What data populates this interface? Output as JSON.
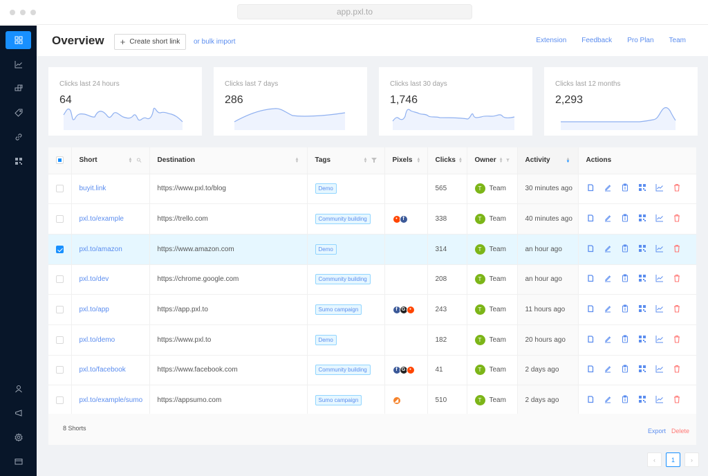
{
  "browser": {
    "url": "app.pxl.to"
  },
  "sidebar": {
    "items": [
      {
        "icon": "dashboard-icon",
        "active": true
      },
      {
        "icon": "analytics-icon",
        "active": false
      },
      {
        "icon": "blocks-icon",
        "active": false
      },
      {
        "icon": "tag-icon",
        "active": false
      },
      {
        "icon": "link-icon",
        "active": false
      },
      {
        "icon": "qr-code-icon",
        "active": false
      }
    ],
    "bottom_items": [
      {
        "icon": "user-icon"
      },
      {
        "icon": "megaphone-icon"
      },
      {
        "icon": "gear-icon"
      },
      {
        "icon": "billing-card-icon"
      }
    ]
  },
  "header": {
    "title": "Overview",
    "create_button": "Create short link",
    "bulk_import": "or bulk import",
    "nav": [
      "Extension",
      "Feedback",
      "Pro Plan",
      "Team"
    ]
  },
  "stats": [
    {
      "label": "Clicks last 24 hours",
      "value": "64"
    },
    {
      "label": "Clicks last 7 days",
      "value": "286"
    },
    {
      "label": "Clicks last 30 days",
      "value": "1,746"
    },
    {
      "label": "Clicks last 12 months",
      "value": "2,293"
    }
  ],
  "table": {
    "columns": [
      "Short",
      "Destination",
      "Tags",
      "Pixels",
      "Clicks",
      "Owner",
      "Activity",
      "Actions"
    ],
    "rows": [
      {
        "short": "buyit.link",
        "destination": "https://www.pxl.to/blog",
        "tag": "Demo",
        "pixels": [],
        "clicks": "565",
        "owner": "Team",
        "owner_initial": "T",
        "activity": "30 minutes ago",
        "selected": false
      },
      {
        "short": "pxl.to/example",
        "destination": "https://trello.com",
        "tag": "Community building",
        "pixels": [
          "reddit",
          "facebook"
        ],
        "clicks": "338",
        "owner": "Team",
        "owner_initial": "T",
        "activity": "40 minutes ago",
        "selected": false
      },
      {
        "short": "pxl.to/amazon",
        "destination": "https://www.amazon.com",
        "tag": "Demo",
        "pixels": [],
        "clicks": "314",
        "owner": "Team",
        "owner_initial": "T",
        "activity": "an hour ago",
        "selected": true
      },
      {
        "short": "pxl.to/dev",
        "destination": "https://chrome.google.com",
        "tag": "Community building",
        "pixels": [],
        "clicks": "208",
        "owner": "Team",
        "owner_initial": "T",
        "activity": "an hour ago",
        "selected": false
      },
      {
        "short": "pxl.to/app",
        "destination": "https://app.pxl.to",
        "tag": "Sumo campaign",
        "pixels": [
          "facebook",
          "google",
          "reddit"
        ],
        "clicks": "243",
        "owner": "Team",
        "owner_initial": "T",
        "activity": "11 hours ago",
        "selected": false
      },
      {
        "short": "pxl.to/demo",
        "destination": "https://www.pxl.to",
        "tag": "Demo",
        "pixels": [],
        "clicks": "182",
        "owner": "Team",
        "owner_initial": "T",
        "activity": "20 hours ago",
        "selected": false
      },
      {
        "short": "pxl.to/facebook",
        "destination": "https://www.facebook.com",
        "tag": "Community building",
        "pixels": [
          "facebook",
          "google",
          "reddit"
        ],
        "clicks": "41",
        "owner": "Team",
        "owner_initial": "T",
        "activity": "2 days ago",
        "selected": false
      },
      {
        "short": "pxl.to/example/sumo",
        "destination": "https://appsumo.com",
        "tag": "Sumo campaign",
        "pixels": [
          "other"
        ],
        "clicks": "510",
        "owner": "Team",
        "owner_initial": "T",
        "activity": "2 days ago",
        "selected": false
      }
    ],
    "actions": [
      "copy-icon",
      "edit-icon",
      "clipboard-icon",
      "qr-code-icon",
      "analytics-icon",
      "delete-icon"
    ]
  },
  "footer": {
    "total": "8 Shorts",
    "export": "Export",
    "delete": "Delete"
  },
  "pagination": {
    "current": "1",
    "prev": "‹",
    "next": "›"
  },
  "colors": {
    "accent": "#1890ff",
    "link": "#5b8def",
    "danger": "#ff7875",
    "sidebar_bg": "#081629",
    "avatar": "#7cb518"
  }
}
